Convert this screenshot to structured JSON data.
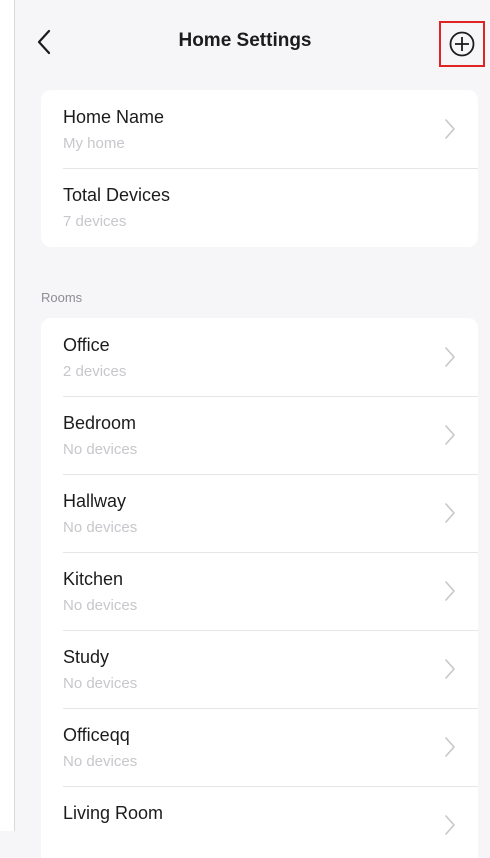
{
  "header": {
    "title": "Home Settings",
    "back_icon": "chevron-left-icon",
    "add_icon": "plus-circle-icon",
    "highlight_color": "#e02424"
  },
  "home": {
    "items": [
      {
        "title": "Home Name",
        "subtitle": "My home",
        "has_chevron": true
      },
      {
        "title": "Total Devices",
        "subtitle": "7 devices",
        "has_chevron": false
      }
    ]
  },
  "rooms": {
    "section_label": "Rooms",
    "items": [
      {
        "title": "Office",
        "subtitle": "2 devices"
      },
      {
        "title": "Bedroom",
        "subtitle": "No devices"
      },
      {
        "title": "Hallway",
        "subtitle": "No devices"
      },
      {
        "title": "Kitchen",
        "subtitle": "No devices"
      },
      {
        "title": "Study",
        "subtitle": "No devices"
      },
      {
        "title": "Officeqq",
        "subtitle": "No devices"
      },
      {
        "title": "Living Room",
        "subtitle": ""
      }
    ]
  }
}
